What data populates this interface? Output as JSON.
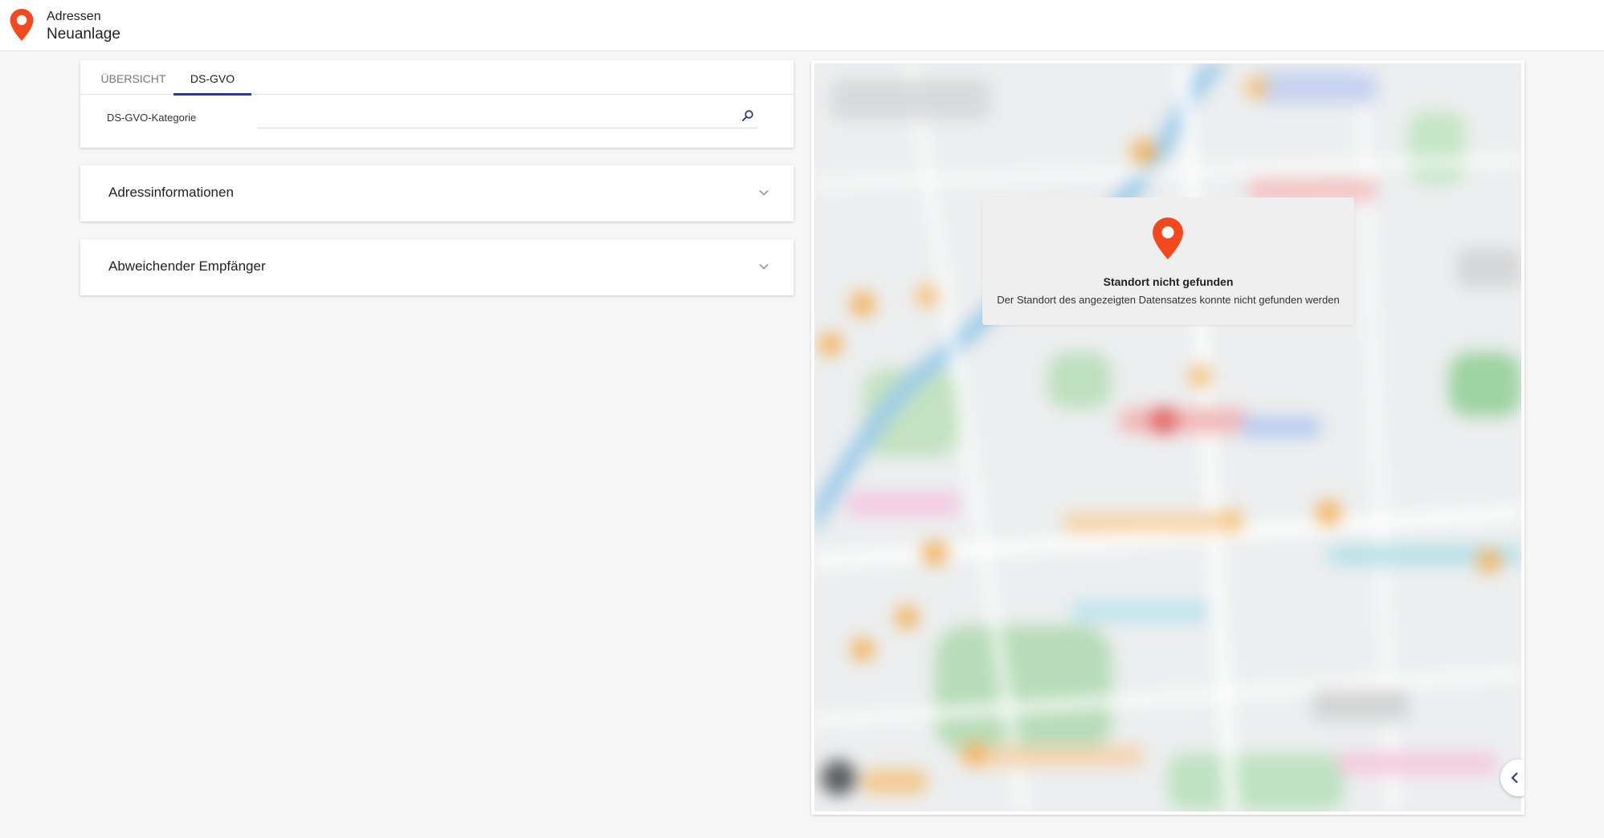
{
  "header": {
    "subtitle": "Adressen",
    "title": "Neuanlage",
    "logo_icon": "location-pin-icon",
    "brand_color": "#f2491f"
  },
  "tabs": [
    {
      "label": "ÜBERSICHT",
      "active": false
    },
    {
      "label": "DS-GVO",
      "active": true
    }
  ],
  "form": {
    "category_label": "DS-GVO-Kategorie",
    "category_value": "",
    "category_placeholder": "",
    "search_icon": "search-icon"
  },
  "accordions": [
    {
      "title": "Adressinformationen",
      "expanded": false
    },
    {
      "title": "Abweichender Empfänger",
      "expanded": false
    }
  ],
  "map": {
    "message_title": "Standort nicht gefunden",
    "message_text": "Der Standort des angezeigten Datensatzes konnte nicht gefunden werden",
    "pin_icon": "location-pin-icon",
    "collapse_icon": "chevron-left-icon"
  },
  "colors": {
    "accent": "#2e3d8a",
    "pin": "#f2491f"
  }
}
